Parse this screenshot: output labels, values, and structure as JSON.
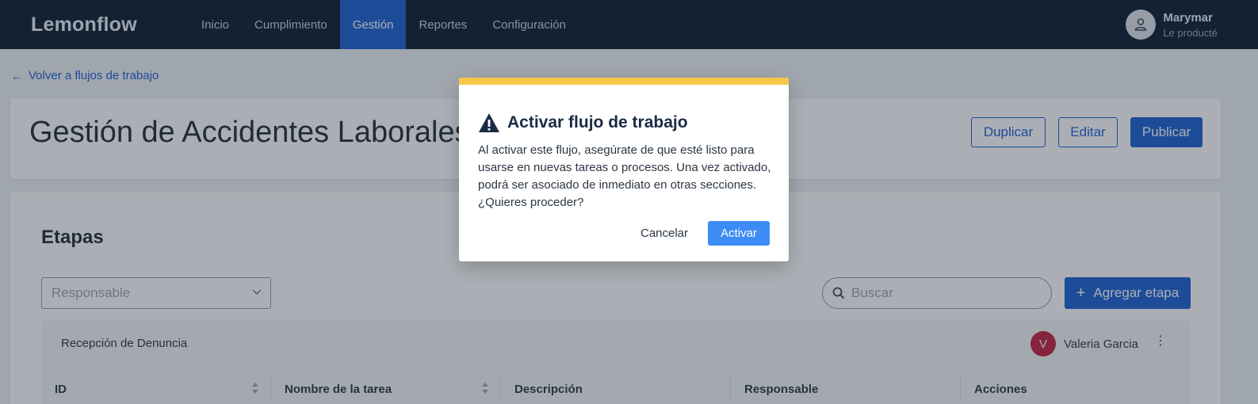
{
  "app": {
    "brand": "Lemonflow",
    "nav": [
      {
        "label": "Inicio",
        "active": false
      },
      {
        "label": "Cumplimiento",
        "active": false
      },
      {
        "label": "Gestión",
        "active": true
      },
      {
        "label": "Reportes",
        "active": false
      },
      {
        "label": "Configuración",
        "active": false
      }
    ],
    "user": {
      "name": "Marymar",
      "role": "Le producté",
      "icon": "person-icon"
    }
  },
  "page": {
    "back_link": "Volver a flujos de trabajo",
    "title": "Gestión de Accidentes Laborales",
    "actions": {
      "duplicate": "Duplicar",
      "edit": "Editar",
      "publish": "Publicar"
    }
  },
  "stages": {
    "title": "Etapas",
    "filter_placeholder": "Responsable",
    "search_placeholder": "Buscar",
    "add_label": "Agregar etapa",
    "panel": {
      "name": "Recepción de Denuncia",
      "assignee_initial": "V",
      "assignee_name": "Valeria Garcia"
    },
    "columns": [
      "ID",
      "Nombre de la tarea",
      "Descripción",
      "Responsable",
      "Acciones"
    ]
  },
  "modal": {
    "title": "Activar flujo de trabajo",
    "body": "Al activar este flujo, asegúrate de que esté listo para usarse en nuevas tareas o procesos. Una vez activado, podrá ser asociado de inmediato en otras secciones. ¿Quieres proceder?",
    "cancel_label": "Cancelar",
    "confirm_label": "Activar",
    "accent_color": "#f9c84a",
    "icon": "warning-icon"
  },
  "colors": {
    "nav_bg": "#0a1a2e",
    "primary": "#1a5fd1",
    "confirm": "#3d8bf5",
    "avatar_red": "#c2203a"
  }
}
